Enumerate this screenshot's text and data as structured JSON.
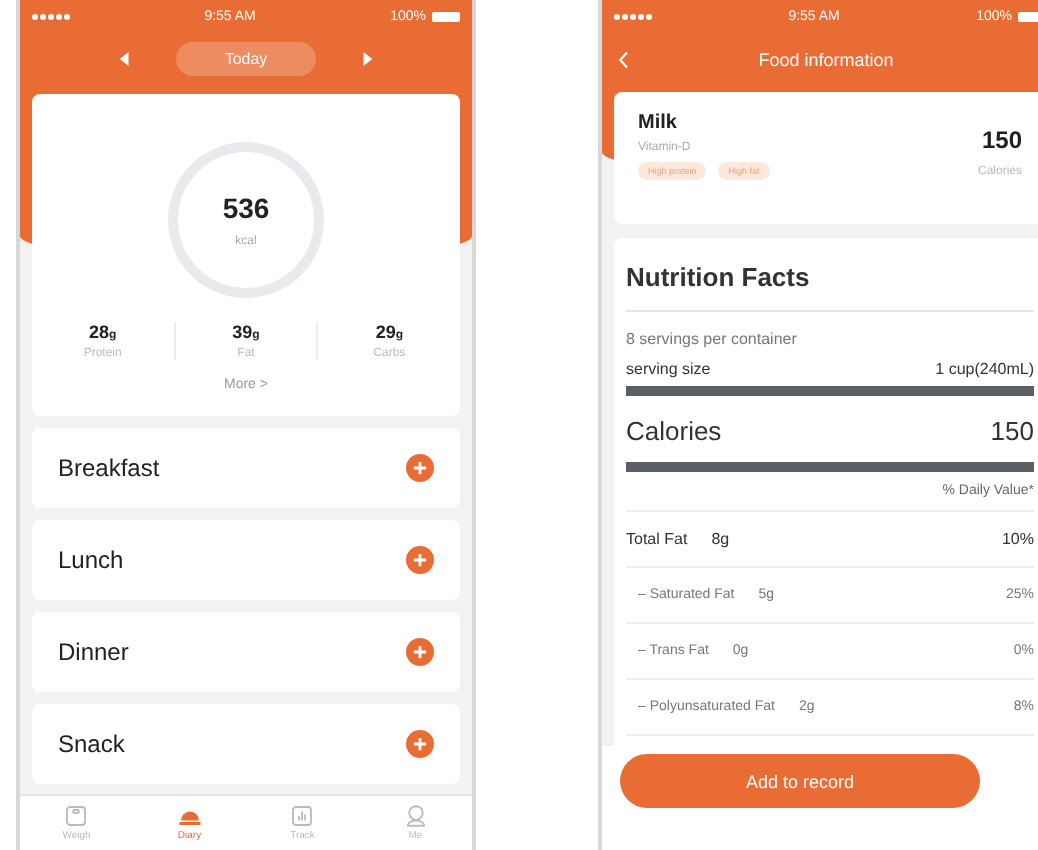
{
  "diary": {
    "status_bar": {
      "time": "9:55 AM",
      "battery": "100%"
    },
    "date_nav": {
      "label": "Today"
    },
    "summary": {
      "calories": "536",
      "unit": "kcal",
      "macros": [
        {
          "value": "28",
          "unit": "g",
          "label": "Protein"
        },
        {
          "value": "39",
          "unit": "g",
          "label": "Fat"
        },
        {
          "value": "29",
          "unit": "g",
          "label": "Carbs"
        }
      ],
      "more": "More >"
    },
    "meals": [
      {
        "name": "Breakfast"
      },
      {
        "name": "Lunch"
      },
      {
        "name": "Dinner"
      },
      {
        "name": "Snack"
      }
    ],
    "tabs": [
      {
        "label": "Weigh",
        "kind": "scale",
        "selected": false
      },
      {
        "label": "Diary",
        "kind": "cloche",
        "selected": true
      },
      {
        "label": "Track",
        "kind": "chart",
        "selected": false
      },
      {
        "label": "Me",
        "kind": "person",
        "selected": false
      }
    ]
  },
  "food": {
    "status_bar": {
      "time": "9:55 AM",
      "battery": "100%"
    },
    "title": "Food information",
    "item": {
      "name": "Milk",
      "subtitle": "Vitamin-D",
      "tags": [
        "High protein",
        "High fat"
      ],
      "calories": "150",
      "calories_label": "Calories"
    },
    "facts": {
      "title": "Nutrition Facts",
      "servings": "8 servings per container",
      "serving_label": "serving size",
      "serving_value": "1 cup(240mL)",
      "calories_label": "Calories",
      "calories": "150",
      "daily_header": "% Daily Value*",
      "rows": [
        {
          "kind": "main",
          "label": "Total Fat",
          "amount": "8g",
          "percent": "10%"
        },
        {
          "kind": "sub",
          "label": "– Saturated Fat",
          "amount": "5g",
          "percent": "25%"
        },
        {
          "kind": "sub",
          "label": "– Trans Fat",
          "amount": "0g",
          "percent": "0%"
        },
        {
          "kind": "sub",
          "label": "– Polyunsaturated Fat",
          "amount": "2g",
          "percent": "8%"
        }
      ]
    },
    "button": "Add to record"
  }
}
